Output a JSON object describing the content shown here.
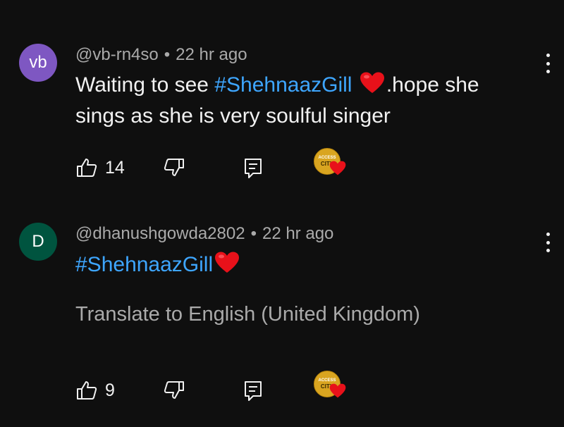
{
  "comments": [
    {
      "avatar_text": "vb",
      "avatar_color": "#7e57c2",
      "author": "@vb-rn4so",
      "separator": "•",
      "time": "22 hr ago",
      "text_before": "Waiting to see ",
      "hashtag": "#ShehnaazGill",
      "text_after": ".hope she sings as she is very soulful singer",
      "likes": "14",
      "badge_line1": "ACCESS",
      "badge_line2": "CITY"
    },
    {
      "avatar_text": "D",
      "avatar_color": "#00543f",
      "author": "@dhanushgowda2802",
      "separator": "•",
      "time": "22 hr ago",
      "hashtag": "#ShehnaazGill",
      "translate_link": "Translate to English (United Kingdom)",
      "likes": "9",
      "badge_line1": "ACCESS",
      "badge_line2": "CITY"
    }
  ],
  "colors": {
    "background": "#0f0f0f",
    "hashtag": "#3ea6ff",
    "secondary_text": "#aaaaaa",
    "heart": "#e8111a",
    "badge_gold": "#d9a520"
  },
  "icons": {
    "like": "thumbs-up-icon",
    "dislike": "thumbs-down-icon",
    "reply": "reply-icon",
    "menu": "more-vertical-icon",
    "heart": "red-heart-icon"
  }
}
